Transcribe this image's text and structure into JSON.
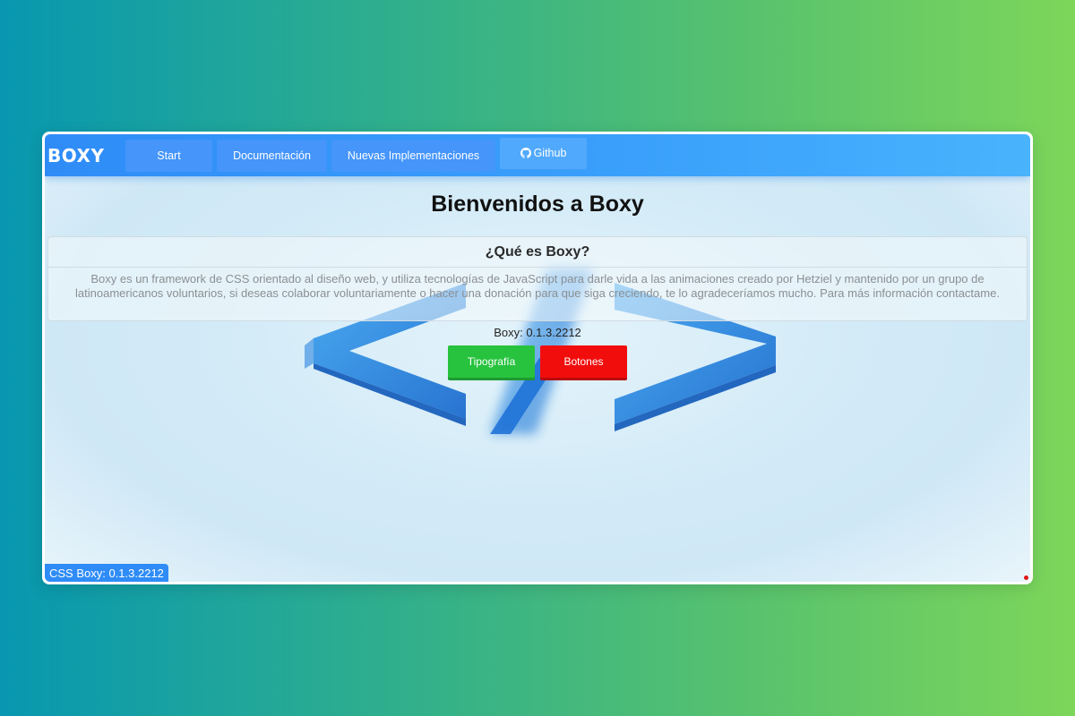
{
  "navbar": {
    "brand": "BOXY",
    "items": [
      {
        "label": "Start"
      },
      {
        "label": "Documentación"
      },
      {
        "label": "Nuevas Implementaciones"
      },
      {
        "label": "Github",
        "icon": "github-icon"
      }
    ]
  },
  "main": {
    "title": "Bienvenidos a Boxy",
    "card": {
      "title": "¿Qué es Boxy?",
      "body": "Boxy es un framework de CSS orientado al diseño web, y utiliza tecnologías de JavaScript para darle vida a las animaciones creado por Hetziel y mantenido por un grupo de latinoamericanos voluntarios, si deseas colaborar voluntariamente o hacer una donación para que siga creciendo, te lo agradeceríamos mucho. Para más información contactame."
    },
    "version": "Boxy: 0.1.3.2212",
    "buttons": {
      "typography": "Tipografía",
      "buttons": "Botones"
    }
  },
  "footer": {
    "badge": "CSS Boxy: 0.1.3.2212"
  },
  "colors": {
    "navbar": "#2f8cf7",
    "green_button": "#27c33e",
    "red_button": "#f20d0d",
    "background_start": "#0797b0",
    "background_end": "#7dd65a"
  }
}
